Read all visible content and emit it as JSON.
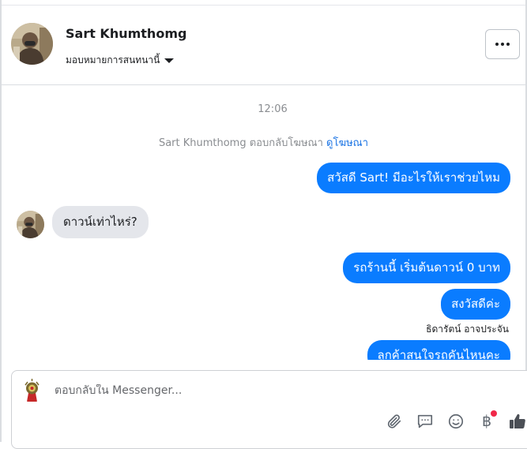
{
  "header": {
    "contact_name": "Sart Khumthomg",
    "assign_label": "มอบหมายการสนทนานี้"
  },
  "conversation": {
    "time": "12:06",
    "ad_reply_text": "Sart Khumthomg ตอบกลับโฆษณา",
    "ad_reply_link": "ดูโฆษณา",
    "messages": [
      {
        "direction": "outgoing",
        "text": "สวัสดี Sart! มีอะไรให้เราช่วยไหม"
      },
      {
        "direction": "incoming",
        "text": "ดาวน์เท่าไหร่?"
      },
      {
        "direction": "outgoing",
        "text": "รถร้านนี้ เริ่มต้นดาวน์ 0 บาท"
      },
      {
        "direction": "outgoing",
        "text": "สงวัสดีค่ะ"
      },
      {
        "direction": "outgoing",
        "text": "ลูกค้าสนใจรถคันไหนคะ"
      }
    ],
    "sender_label": "ธิดารัตน์ อาจประจัน"
  },
  "composer": {
    "placeholder": "ตอบกลับใน Messenger..."
  },
  "colors": {
    "accent": "#0a7cff",
    "incoming_bubble": "#e4e6eb",
    "link": "#1b74e4",
    "notification": "#f02849"
  },
  "icons": [
    "more-icon",
    "caret-down-icon",
    "paperclip-icon",
    "saved-replies-icon",
    "emoji-icon",
    "baht-icon",
    "like-icon"
  ]
}
